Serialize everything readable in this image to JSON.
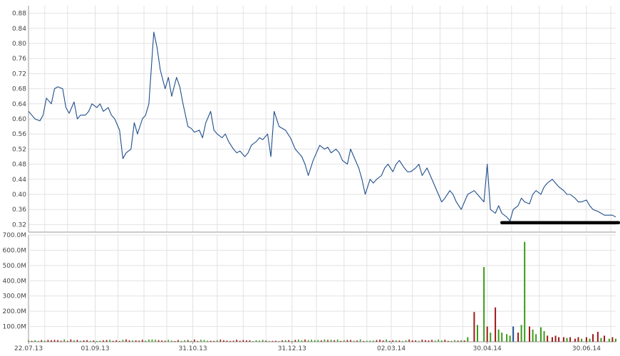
{
  "colors": {
    "price_line": "#1f4e8c",
    "grid": "#e2e2e2",
    "axis": "#999999",
    "support_line": "#000000",
    "volume_up": "#3a9a1a",
    "volume_down": "#a01818",
    "volume_neutral": "#1f4e8c"
  },
  "chart_data": [
    {
      "type": "line",
      "name_hint": "price",
      "ylim": [
        0.3,
        0.9
      ],
      "y_ticks": [
        "0.88",
        "0.84",
        "0.80",
        "0.76",
        "0.72",
        "0.68",
        "0.64",
        "0.60",
        "0.56",
        "0.52",
        "0.48",
        "0.44",
        "0.40",
        "0.36",
        "0.32"
      ],
      "x_range": [
        "2013-07-22",
        "2014-07-18"
      ],
      "x": [
        "2013-07-22",
        "2013-07-24",
        "2013-07-26",
        "2013-07-29",
        "2013-07-31",
        "2013-08-02",
        "2013-08-05",
        "2013-08-07",
        "2013-08-09",
        "2013-08-12",
        "2013-08-14",
        "2013-08-16",
        "2013-08-19",
        "2013-08-21",
        "2013-08-23",
        "2013-08-26",
        "2013-08-28",
        "2013-08-30",
        "2013-09-02",
        "2013-09-04",
        "2013-09-06",
        "2013-09-09",
        "2013-09-11",
        "2013-09-13",
        "2013-09-16",
        "2013-09-18",
        "2013-09-20",
        "2013-09-23",
        "2013-09-25",
        "2013-09-27",
        "2013-09-30",
        "2013-10-02",
        "2013-10-04",
        "2013-10-07",
        "2013-10-09",
        "2013-10-11",
        "2013-10-14",
        "2013-10-16",
        "2013-10-18",
        "2013-10-21",
        "2013-10-23",
        "2013-10-25",
        "2013-10-28",
        "2013-10-30",
        "2013-11-01",
        "2013-11-04",
        "2013-11-06",
        "2013-11-08",
        "2013-11-11",
        "2013-11-13",
        "2013-11-15",
        "2013-11-18",
        "2013-11-20",
        "2013-11-22",
        "2013-11-25",
        "2013-11-27",
        "2013-11-29",
        "2013-12-02",
        "2013-12-04",
        "2013-12-06",
        "2013-12-09",
        "2013-12-11",
        "2013-12-13",
        "2013-12-16",
        "2013-12-18",
        "2013-12-20",
        "2013-12-23",
        "2013-12-27",
        "2013-12-30",
        "2014-01-02",
        "2014-01-06",
        "2014-01-08",
        "2014-01-10",
        "2014-01-13",
        "2014-01-15",
        "2014-01-17",
        "2014-01-20",
        "2014-01-22",
        "2014-01-24",
        "2014-01-27",
        "2014-01-29",
        "2014-01-31",
        "2014-02-03",
        "2014-02-05",
        "2014-02-07",
        "2014-02-10",
        "2014-02-12",
        "2014-02-14",
        "2014-02-17",
        "2014-02-19",
        "2014-02-21",
        "2014-02-24",
        "2014-02-26",
        "2014-02-28",
        "2014-03-03",
        "2014-03-05",
        "2014-03-07",
        "2014-03-10",
        "2014-03-12",
        "2014-03-14",
        "2014-03-17",
        "2014-03-19",
        "2014-03-21",
        "2014-03-24",
        "2014-03-26",
        "2014-03-28",
        "2014-03-31",
        "2014-04-02",
        "2014-04-04",
        "2014-04-07",
        "2014-04-09",
        "2014-04-11",
        "2014-04-14",
        "2014-04-16",
        "2014-04-18",
        "2014-04-22",
        "2014-04-24",
        "2014-04-28",
        "2014-04-30",
        "2014-05-02",
        "2014-05-05",
        "2014-05-07",
        "2014-05-09",
        "2014-05-12",
        "2014-05-14",
        "2014-05-16",
        "2014-05-19",
        "2014-05-21",
        "2014-05-23",
        "2014-05-26",
        "2014-05-28",
        "2014-05-30",
        "2014-06-02",
        "2014-06-04",
        "2014-06-06",
        "2014-06-09",
        "2014-06-11",
        "2014-06-13",
        "2014-06-16",
        "2014-06-18",
        "2014-06-20",
        "2014-06-23",
        "2014-06-25",
        "2014-06-27",
        "2014-06-30",
        "2014-07-02",
        "2014-07-04",
        "2014-07-07",
        "2014-07-09",
        "2014-07-11",
        "2014-07-14",
        "2014-07-16",
        "2014-07-18"
      ],
      "values": [
        0.62,
        0.61,
        0.6,
        0.595,
        0.61,
        0.655,
        0.64,
        0.68,
        0.685,
        0.68,
        0.63,
        0.615,
        0.645,
        0.6,
        0.61,
        0.61,
        0.62,
        0.64,
        0.63,
        0.64,
        0.62,
        0.63,
        0.61,
        0.6,
        0.57,
        0.495,
        0.51,
        0.52,
        0.59,
        0.56,
        0.6,
        0.61,
        0.64,
        0.83,
        0.79,
        0.73,
        0.68,
        0.71,
        0.66,
        0.71,
        0.685,
        0.64,
        0.58,
        0.575,
        0.565,
        0.57,
        0.55,
        0.59,
        0.62,
        0.57,
        0.56,
        0.55,
        0.56,
        0.54,
        0.52,
        0.51,
        0.515,
        0.5,
        0.51,
        0.53,
        0.54,
        0.55,
        0.545,
        0.56,
        0.5,
        0.62,
        0.58,
        0.57,
        0.55,
        0.52,
        0.5,
        0.48,
        0.45,
        0.49,
        0.51,
        0.53,
        0.52,
        0.525,
        0.51,
        0.52,
        0.51,
        0.49,
        0.48,
        0.52,
        0.5,
        0.47,
        0.44,
        0.4,
        0.44,
        0.43,
        0.44,
        0.45,
        0.47,
        0.48,
        0.46,
        0.48,
        0.49,
        0.47,
        0.46,
        0.46,
        0.47,
        0.48,
        0.45,
        0.47,
        0.45,
        0.43,
        0.4,
        0.38,
        0.39,
        0.41,
        0.4,
        0.38,
        0.36,
        0.38,
        0.4,
        0.41,
        0.4,
        0.38,
        0.48,
        0.36,
        0.35,
        0.37,
        0.35,
        0.34,
        0.33,
        0.36,
        0.37,
        0.39,
        0.38,
        0.375,
        0.4,
        0.41,
        0.4,
        0.42,
        0.43,
        0.44,
        0.43,
        0.42,
        0.41,
        0.4,
        0.4,
        0.39,
        0.38,
        0.38,
        0.385,
        0.37,
        0.36,
        0.355,
        0.35,
        0.345,
        0.345,
        0.345,
        0.34,
        0.34
      ],
      "support_line": {
        "from": "2014-05-09",
        "to": "2014-07-18",
        "value": 0.325
      }
    },
    {
      "type": "bar",
      "name_hint": "volume",
      "ylim": [
        0,
        700000000
      ],
      "y_ticks": [
        "700.0M",
        "600.0M",
        "500.0M",
        "400.0M",
        "300.0M",
        "200.0M",
        "100.0M"
      ],
      "x_ticks": [
        "22.07.13",
        "01.09.13",
        "31.10.13",
        "31.12.13",
        "02.03.14",
        "30.04.14",
        "30.06.14"
      ],
      "bars": [
        {
          "date": "2014-04-14",
          "value": 10000000,
          "dir": "up"
        },
        {
          "date": "2014-04-16",
          "value": 8000000,
          "dir": "down"
        },
        {
          "date": "2014-04-18",
          "value": 30000000,
          "dir": "up"
        },
        {
          "date": "2014-04-22",
          "value": 195000000,
          "dir": "down"
        },
        {
          "date": "2014-04-24",
          "value": 110000000,
          "dir": "up"
        },
        {
          "date": "2014-04-28",
          "value": 490000000,
          "dir": "up"
        },
        {
          "date": "2014-04-30",
          "value": 100000000,
          "dir": "down"
        },
        {
          "date": "2014-05-02",
          "value": 60000000,
          "dir": "up"
        },
        {
          "date": "2014-05-05",
          "value": 225000000,
          "dir": "down"
        },
        {
          "date": "2014-05-07",
          "value": 80000000,
          "dir": "up"
        },
        {
          "date": "2014-05-09",
          "value": 60000000,
          "dir": "up"
        },
        {
          "date": "2014-05-12",
          "value": 50000000,
          "dir": "up"
        },
        {
          "date": "2014-05-14",
          "value": 40000000,
          "dir": "up"
        },
        {
          "date": "2014-05-16",
          "value": 100000000,
          "dir": "neutral"
        },
        {
          "date": "2014-05-19",
          "value": 60000000,
          "dir": "down"
        },
        {
          "date": "2014-05-21",
          "value": 110000000,
          "dir": "up"
        },
        {
          "date": "2014-05-23",
          "value": 655000000,
          "dir": "up"
        },
        {
          "date": "2014-05-26",
          "value": 100000000,
          "dir": "down"
        },
        {
          "date": "2014-05-28",
          "value": 80000000,
          "dir": "up"
        },
        {
          "date": "2014-05-30",
          "value": 50000000,
          "dir": "up"
        },
        {
          "date": "2014-06-02",
          "value": 95000000,
          "dir": "up"
        },
        {
          "date": "2014-06-04",
          "value": 70000000,
          "dir": "up"
        },
        {
          "date": "2014-06-06",
          "value": 40000000,
          "dir": "down"
        },
        {
          "date": "2014-06-09",
          "value": 30000000,
          "dir": "down"
        },
        {
          "date": "2014-06-11",
          "value": 40000000,
          "dir": "down"
        },
        {
          "date": "2014-06-13",
          "value": 30000000,
          "dir": "down"
        },
        {
          "date": "2014-06-16",
          "value": 30000000,
          "dir": "down"
        },
        {
          "date": "2014-06-18",
          "value": 25000000,
          "dir": "up"
        },
        {
          "date": "2014-06-20",
          "value": 30000000,
          "dir": "down"
        },
        {
          "date": "2014-06-23",
          "value": 20000000,
          "dir": "down"
        },
        {
          "date": "2014-06-25",
          "value": 30000000,
          "dir": "down"
        },
        {
          "date": "2014-06-27",
          "value": 20000000,
          "dir": "up"
        },
        {
          "date": "2014-06-30",
          "value": 30000000,
          "dir": "down"
        },
        {
          "date": "2014-07-02",
          "value": 20000000,
          "dir": "up"
        },
        {
          "date": "2014-07-04",
          "value": 50000000,
          "dir": "down"
        },
        {
          "date": "2014-07-07",
          "value": 65000000,
          "dir": "down"
        },
        {
          "date": "2014-07-09",
          "value": 25000000,
          "dir": "up"
        },
        {
          "date": "2014-07-11",
          "value": 40000000,
          "dir": "down"
        },
        {
          "date": "2014-07-14",
          "value": 20000000,
          "dir": "up"
        },
        {
          "date": "2014-07-16",
          "value": 30000000,
          "dir": "down"
        },
        {
          "date": "2014-07-18",
          "value": 20000000,
          "dir": "up"
        }
      ],
      "baseline_activity": "small volume bars present on most days before mid-April 2014"
    }
  ]
}
